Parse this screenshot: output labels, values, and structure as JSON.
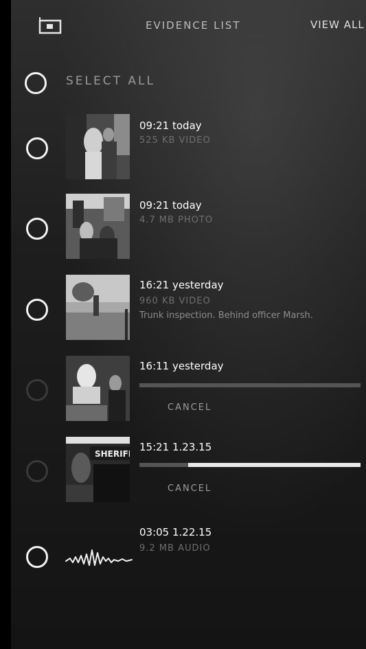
{
  "header": {
    "icon": "camera-icon",
    "title": "EVIDENCE LIST",
    "view_all": "VIEW ALL"
  },
  "select_all": {
    "label": "SELECT ALL"
  },
  "items": [
    {
      "title": "09:21 today",
      "meta": "525 KB VIDEO",
      "selected": false
    },
    {
      "title": "09:21 today",
      "meta": "4.7 MB PHOTO",
      "selected": false
    },
    {
      "title": "16:21 yesterday",
      "meta": "960 KB VIDEO",
      "note": "Trunk inspection. Behind officer Marsh.",
      "selected": false
    },
    {
      "title": "16:11 yesterday",
      "status": "uploading",
      "progress": 0.0,
      "cancel": "CANCEL"
    },
    {
      "title": "15:21 1.23.15",
      "status": "uploading",
      "progress": 0.78,
      "cancel": "CANCEL"
    },
    {
      "title": "03:05 1.22.15",
      "meta": "9.2 MB AUDIO",
      "icon": "waveform-icon",
      "selected": false
    }
  ],
  "colors": {
    "background": "#1d1d1d",
    "text": "#ffffff",
    "muted": "#6f6f6f",
    "progress_fill": "#e9e9e9",
    "progress_track": "#555555"
  }
}
